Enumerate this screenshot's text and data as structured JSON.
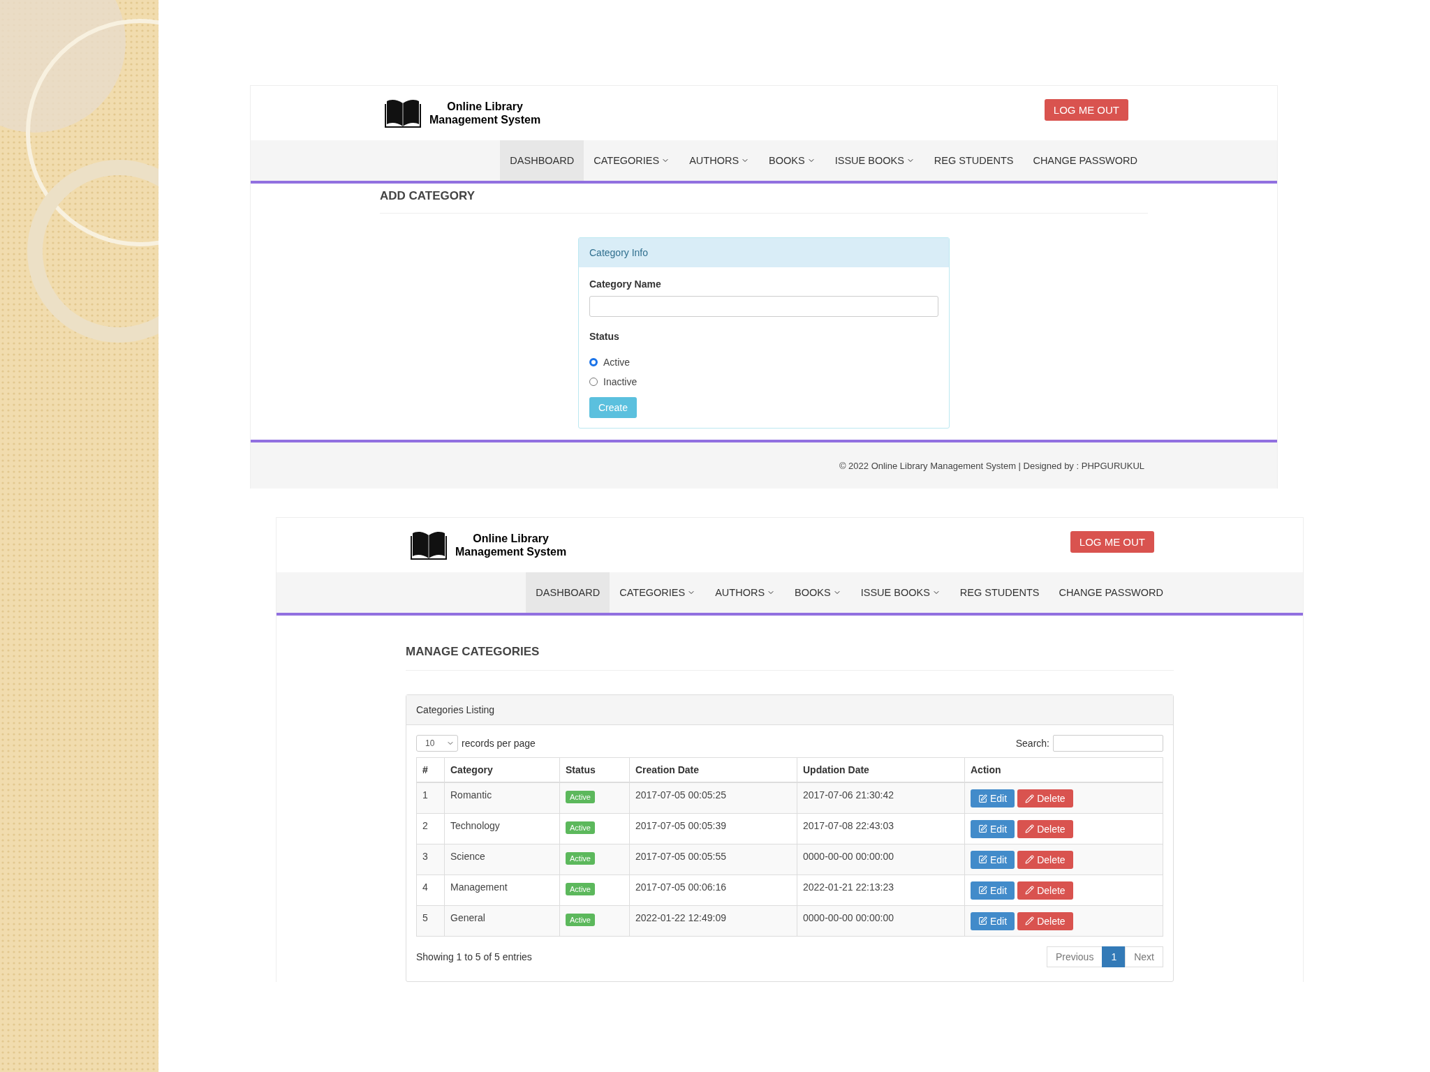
{
  "screens": [
    {
      "kind": "add_category",
      "header": {
        "title_lines": [
          "Online Library",
          "Management System"
        ],
        "logout": "LOG ME OUT"
      },
      "nav": [
        {
          "label": "DASHBOARD",
          "dropdown": false,
          "selected": true
        },
        {
          "label": "CATEGORIES",
          "dropdown": true,
          "selected": false
        },
        {
          "label": "AUTHORS",
          "dropdown": true,
          "selected": false
        },
        {
          "label": "BOOKS",
          "dropdown": true,
          "selected": false
        },
        {
          "label": "ISSUE BOOKS",
          "dropdown": true,
          "selected": false
        },
        {
          "label": "REG STUDENTS",
          "dropdown": false,
          "selected": false
        },
        {
          "label": "CHANGE PASSWORD",
          "dropdown": false,
          "selected": false
        }
      ],
      "page_title": "ADD CATEGORY",
      "card": {
        "title": "Category Info",
        "field_label": "Category Name",
        "status_label": "Status",
        "options": [
          {
            "label": "Active",
            "selected": true
          },
          {
            "label": "Inactive",
            "selected": false
          }
        ],
        "submit": "Create"
      },
      "footer": "© 2022 Online Library Management System | Designed by : PHPGURUKUL"
    },
    {
      "kind": "manage_categories",
      "header": {
        "title_lines": [
          "Online Library",
          "Management System"
        ],
        "logout": "LOG ME OUT"
      },
      "nav": [
        {
          "label": "DASHBOARD",
          "dropdown": false,
          "selected": true
        },
        {
          "label": "CATEGORIES",
          "dropdown": true,
          "selected": false
        },
        {
          "label": "AUTHORS",
          "dropdown": true,
          "selected": false
        },
        {
          "label": "BOOKS",
          "dropdown": true,
          "selected": false
        },
        {
          "label": "ISSUE BOOKS",
          "dropdown": true,
          "selected": false
        },
        {
          "label": "REG STUDENTS",
          "dropdown": false,
          "selected": false
        },
        {
          "label": "CHANGE PASSWORD",
          "dropdown": false,
          "selected": false
        }
      ],
      "page_title": "MANAGE CATEGORIES",
      "panel": {
        "title": "Categories Listing",
        "page_size": "10",
        "page_size_label": "records per page",
        "search_label": "Search:",
        "columns": [
          "#",
          "Category",
          "Status",
          "Creation Date",
          "Updation Date",
          "Action"
        ],
        "rows": [
          {
            "number": "1",
            "category": "Romantic",
            "status": "Active",
            "created": "2017-07-05 00:05:25",
            "updated": "2017-07-06 21:30:42",
            "actions": [
              "Edit",
              "Delete"
            ]
          },
          {
            "number": "2",
            "category": "Technology",
            "status": "Active",
            "created": "2017-07-05 00:05:39",
            "updated": "2017-07-08 22:43:03",
            "actions": [
              "Edit",
              "Delete"
            ]
          },
          {
            "number": "3",
            "category": "Science",
            "status": "Active",
            "created": "2017-07-05 00:05:55",
            "updated": "0000-00-00 00:00:00",
            "actions": [
              "Edit",
              "Delete"
            ]
          },
          {
            "number": "4",
            "category": "Management",
            "status": "Active",
            "created": "2017-07-05 00:06:16",
            "updated": "2022-01-21 22:13:23",
            "actions": [
              "Edit",
              "Delete"
            ]
          },
          {
            "number": "5",
            "category": "General",
            "status": "Active",
            "created": "2022-01-22 12:49:09",
            "updated": "0000-00-00 00:00:00",
            "actions": [
              "Edit",
              "Delete"
            ]
          }
        ],
        "info": "Showing 1 to 5 of 5 entries",
        "pagination": [
          {
            "label": "Previous",
            "selected": false
          },
          {
            "label": "1",
            "selected": true
          },
          {
            "label": "Next",
            "selected": false
          }
        ]
      }
    }
  ]
}
